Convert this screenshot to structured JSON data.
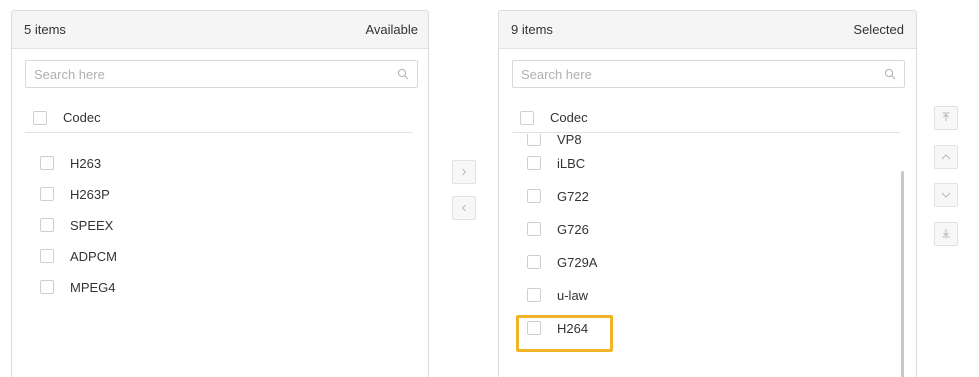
{
  "left_panel": {
    "count_label": "5 items",
    "title": "Available",
    "search_placeholder": "Search here",
    "column_label": "Codec",
    "items": [
      "H263",
      "H263P",
      "SPEEX",
      "ADPCM",
      "MPEG4"
    ]
  },
  "right_panel": {
    "count_label": "9 items",
    "title": "Selected",
    "search_placeholder": "Search here",
    "column_label": "Codec",
    "items": [
      "VP8",
      "iLBC",
      "G722",
      "G726",
      "G729A",
      "u-law",
      "H264"
    ],
    "highlighted_items": [
      "u-law",
      "H264"
    ]
  },
  "transfer_buttons": {
    "move_right_icon": "chevron-right-icon",
    "move_left_icon": "chevron-left-icon"
  },
  "order_buttons": {
    "move_top_icon": "move-top-icon",
    "move_up_icon": "chevron-up-icon",
    "move_down_icon": "chevron-down-icon",
    "move_bottom_icon": "move-bottom-icon"
  },
  "colors": {
    "highlight": "#f0b428",
    "header_bg": "#f5f5f5",
    "border": "#dcdcdc"
  }
}
